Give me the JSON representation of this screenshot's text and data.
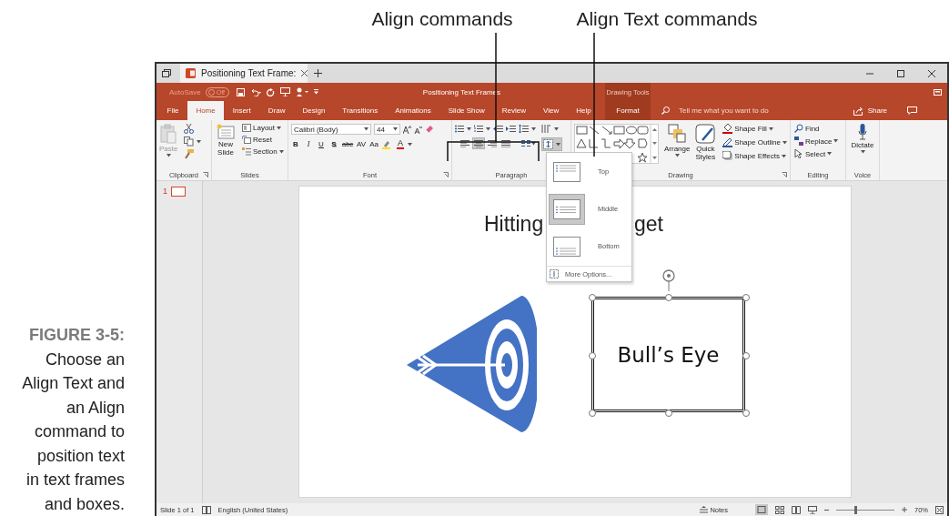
{
  "callouts": [
    {
      "label": "Align commands"
    },
    {
      "label": "Align Text commands"
    }
  ],
  "caption": {
    "figure": "FIGURE 3-5:",
    "text": "Choose an Align Text and an Align command to position text in text frames and boxes."
  },
  "window": {
    "tab_title": "Positioning Text Frame:",
    "title": "Positioning Text Frames",
    "autosave": "AutoSave",
    "autosave_state": "Off",
    "context_group": "Drawing Tools"
  },
  "ribbon_tabs": [
    {
      "label": "File",
      "selected": false
    },
    {
      "label": "Home",
      "selected": true
    },
    {
      "label": "Insert",
      "selected": false
    },
    {
      "label": "Draw",
      "selected": false
    },
    {
      "label": "Design",
      "selected": false
    },
    {
      "label": "Transitions",
      "selected": false
    },
    {
      "label": "Animations",
      "selected": false
    },
    {
      "label": "Slide Show",
      "selected": false
    },
    {
      "label": "Review",
      "selected": false
    },
    {
      "label": "View",
      "selected": false
    },
    {
      "label": "Help",
      "selected": false
    }
  ],
  "context_tab": "Format",
  "tell_me": {
    "placeholder": "Tell me what you want to do"
  },
  "share": "Share",
  "ribbon": {
    "clipboard": {
      "paste": "Paste",
      "label": "Clipboard"
    },
    "slides": {
      "new_slide": "New Slide",
      "layout": "Layout",
      "reset": "Reset",
      "section": "Section",
      "label": "Slides"
    },
    "font": {
      "family": "Calibri (Body)",
      "size": "44",
      "format_buttons": [
        "B",
        "I",
        "U",
        "S",
        "abc",
        "AV",
        "Aa"
      ],
      "font_color": "A",
      "label": "Font"
    },
    "paragraph": {
      "alignments": [
        {
          "kind": "left",
          "selected": false
        },
        {
          "kind": "center",
          "selected": true
        },
        {
          "kind": "right",
          "selected": false
        },
        {
          "kind": "justify",
          "selected": false
        }
      ],
      "label": "Paragraph"
    },
    "drawing": {
      "arrange": "Arrange",
      "quick_styles": "Quick Styles",
      "shape_fill": "Shape Fill",
      "shape_outline": "Shape Outline",
      "shape_effects": "Shape Effects",
      "label": "Drawing"
    },
    "editing": {
      "find": "Find",
      "replace": "Replace",
      "select": "Select",
      "label": "Editing"
    },
    "voice": {
      "dictate": "Dictate",
      "label": "Voice"
    }
  },
  "align_text_menu": {
    "items": [
      {
        "label": "Top",
        "selected": false
      },
      {
        "label": "Middle",
        "selected": true
      },
      {
        "label": "Bottom",
        "selected": false
      }
    ],
    "more_options": "More Options..."
  },
  "slide_pane": {
    "number": "1"
  },
  "slide": {
    "title_left": "Hitting",
    "title_right": "get",
    "textbox": "Bull’s Eye"
  },
  "status_bar": {
    "slide": "Slide 1 of 1",
    "language": "English (United States)",
    "notes": "Notes",
    "zoom": "70%",
    "zoom_slider": {
      "level": 0.33
    }
  }
}
